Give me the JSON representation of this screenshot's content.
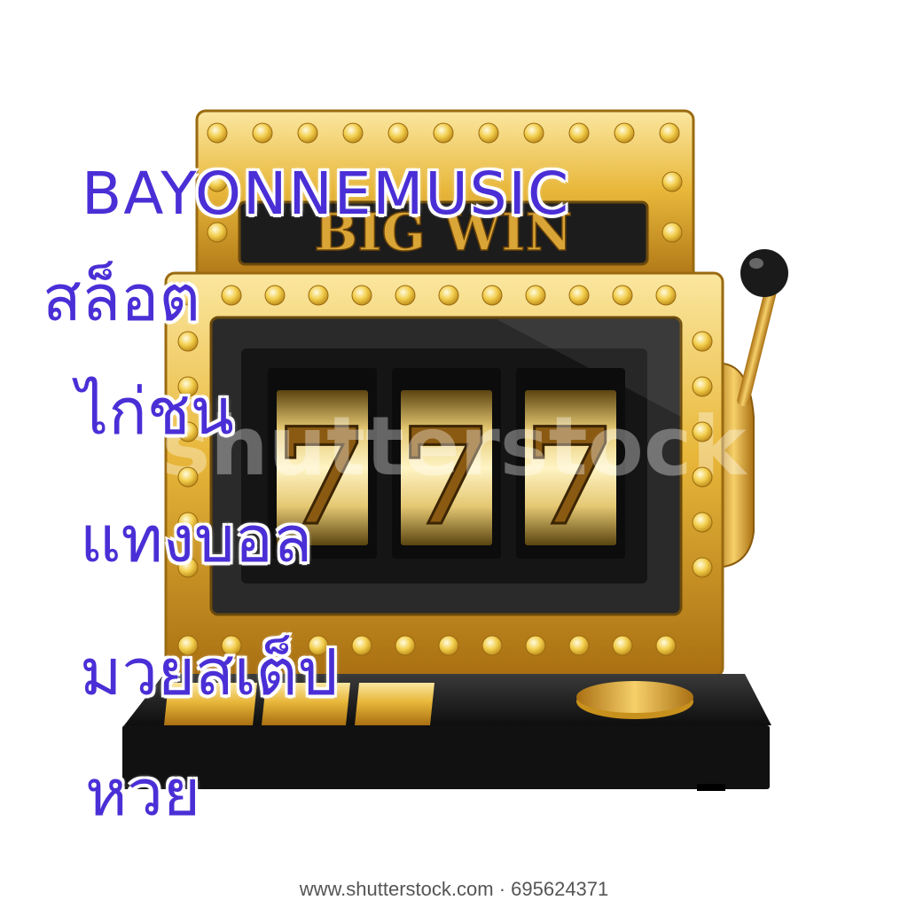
{
  "machine": {
    "sign_text": "BIG WIN",
    "reel_symbols": [
      "7",
      "7",
      "7"
    ],
    "watermark": "shutterstock"
  },
  "overlay": {
    "brand": "BAYONNEMUSIC",
    "line1": "สล็อต",
    "line2": "ไก่ชน",
    "line3": "แทงบอล",
    "line4": "มวยสเต็ป",
    "line5": "หวย"
  },
  "footer": {
    "site": "www.shutterstock.com",
    "separator": " · ",
    "image_number": "695624371"
  },
  "colors": {
    "gold": "#e8b73a",
    "gold_dark": "#b07a14",
    "body_black": "#1b1b1b",
    "overlay_text": "#4a2fd6"
  }
}
